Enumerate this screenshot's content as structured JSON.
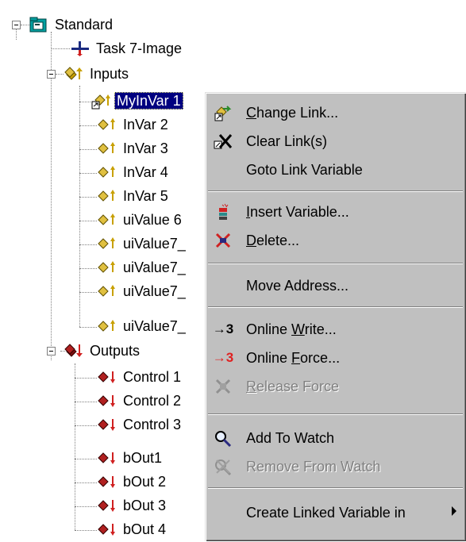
{
  "tree": {
    "root": {
      "label": "Standard",
      "icon": "project-folder-icon",
      "expanded": true
    },
    "task": {
      "label": "Task 7-Image",
      "icon": "task-image-icon"
    },
    "inputs": {
      "label": "Inputs",
      "icon": "inputs-folder-icon",
      "expanded": true,
      "items": [
        "MyInVar 1",
        "InVar 2",
        "InVar 3",
        "InVar 4",
        "InVar 5",
        "uiValue 6",
        "uiValue7_",
        "uiValue7_",
        "uiValue7_",
        "uiValue7_"
      ],
      "selected": "MyInVar 1"
    },
    "outputs": {
      "label": "Outputs",
      "icon": "outputs-folder-icon",
      "expanded": true,
      "items": [
        "Control 1",
        "Control 2",
        "Control 3",
        "bOut1",
        "bOut 2",
        "bOut 3",
        "bOut 4"
      ]
    }
  },
  "context_menu": {
    "items": [
      {
        "label": "Change Link...",
        "icon": "change-link-icon",
        "enabled": true
      },
      {
        "label": "Clear Link(s)",
        "icon": "clear-link-icon",
        "enabled": true
      },
      {
        "label": "Goto Link Variable",
        "icon": "",
        "enabled": true
      },
      {
        "label": "Insert Variable...",
        "icon": "insert-variable-icon",
        "enabled": true
      },
      {
        "label": "Delete...",
        "icon": "delete-icon",
        "enabled": true
      },
      {
        "label": "Move Address...",
        "icon": "",
        "enabled": true
      },
      {
        "label": "Online Write...",
        "icon": "online-write-icon",
        "enabled": true,
        "icon_text": "→3"
      },
      {
        "label": "Online Force...",
        "icon": "online-force-icon",
        "enabled": true,
        "icon_text": "→3"
      },
      {
        "label": "Release Force",
        "icon": "release-force-icon",
        "enabled": false
      },
      {
        "label": "Add To Watch",
        "icon": "magnifier-icon",
        "enabled": true
      },
      {
        "label": "Remove From Watch",
        "icon": "remove-watch-icon",
        "enabled": false
      },
      {
        "label": "Create Linked Variable in",
        "icon": "",
        "enabled": true,
        "submenu": true
      }
    ]
  },
  "colors": {
    "selection": "#000080",
    "menu_bg": "#c0c0c0",
    "input_accent": "#c8a000",
    "output_accent": "#9b1c1c",
    "force_red": "#e02020"
  }
}
